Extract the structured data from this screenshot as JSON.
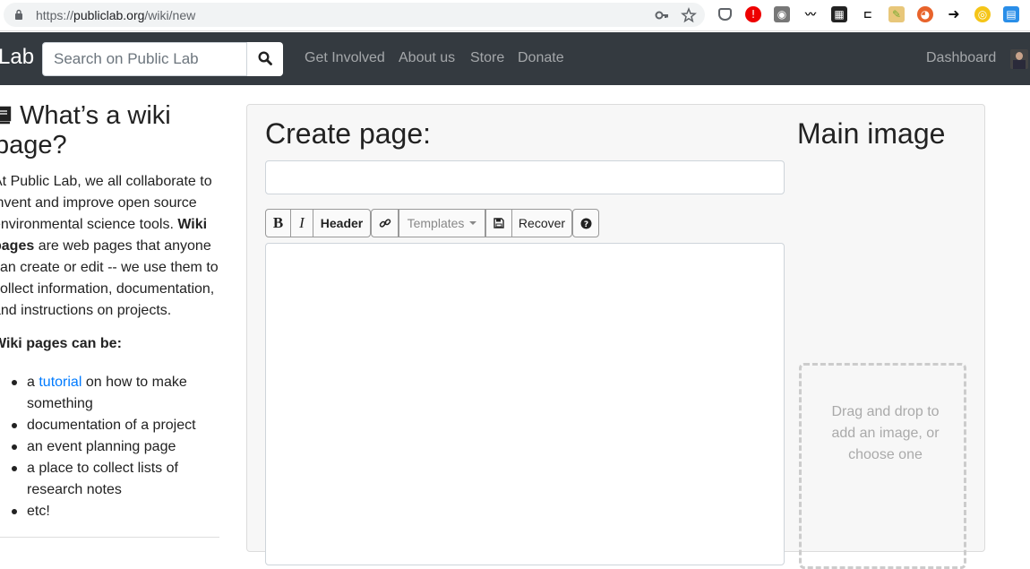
{
  "browser": {
    "url_scheme": "https://",
    "url_host": "publiclab.org",
    "url_path": "/wiki/new"
  },
  "nav": {
    "brand": "Lab",
    "search_placeholder": "Search on Public Lab",
    "links": [
      "Get Involved",
      "About us",
      "Store",
      "Donate"
    ],
    "dashboard": "Dashboard"
  },
  "sidebar": {
    "title": "What’s a wiki page?",
    "intro_1": "At Public Lab, we all collaborate to invent and improve open source environmental science tools. ",
    "intro_bold": "Wiki pages",
    "intro_2": " are web pages that anyone can create or edit -- we use them to collect information, documentation, and instructions on projects.",
    "can_be": "Wiki pages can be:",
    "list_item_1_pre": "a ",
    "list_item_1_link": "tutorial",
    "list_item_1_post": " on how to make something",
    "list_items": [
      "documentation of a project",
      "an event planning page",
      "a place to collect lists of research notes",
      "etc!"
    ]
  },
  "editor": {
    "title": "Create page:",
    "title_value": "",
    "bold": "B",
    "italic": "I",
    "header": "Header",
    "templates": "Templates",
    "recover": "Recover",
    "body_value": ""
  },
  "main_image": {
    "title": "Main image",
    "dropzone_text": "Drag and drop to add an image, or choose one"
  }
}
